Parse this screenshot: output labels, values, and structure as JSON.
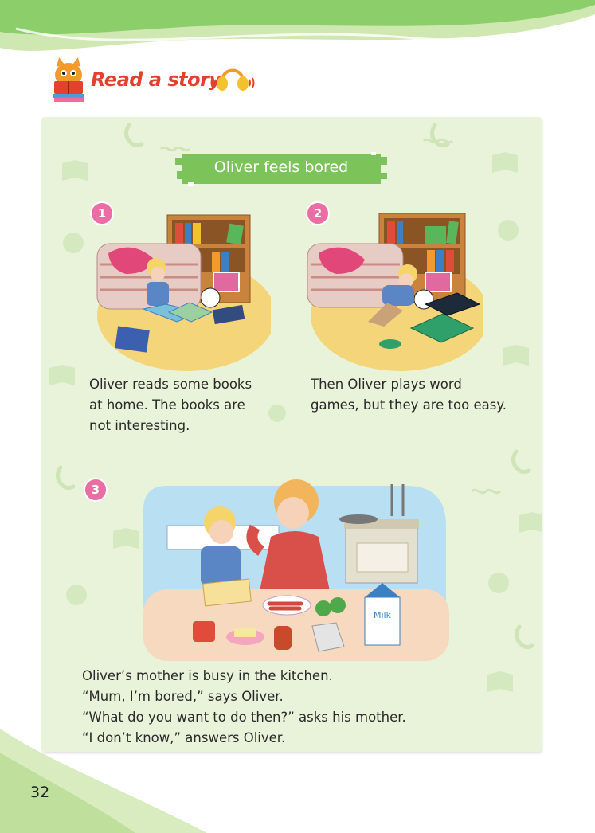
{
  "header": {
    "section_title": "Read a story"
  },
  "story": {
    "title": "Oliver feels bored",
    "panels": [
      {
        "number": "1",
        "lines": [
          "Oliver reads some books",
          "at home. The books are",
          "not interesting."
        ]
      },
      {
        "number": "2",
        "lines": [
          "Then Oliver plays word",
          "games, but they are too easy."
        ]
      },
      {
        "number": "3",
        "lines": [
          "Oliver’s mother is busy in the kitchen.",
          "“Mum, I’m bored,” says Oliver.",
          "“What do you want to do then?” asks his mother.",
          "“I don’t know,” answers Oliver."
        ]
      }
    ],
    "milk_carton_label": "Milk"
  },
  "page_number": "32",
  "colors": {
    "panel_bg": "#e9f3da",
    "banner_green": "#7cc35a",
    "badge_pink": "#ea6ea3",
    "title_red": "#e3402d"
  },
  "icons": [
    "cat-reading-icon",
    "headphones-icon",
    "book-icon",
    "phone-icon",
    "paw-icon"
  ]
}
